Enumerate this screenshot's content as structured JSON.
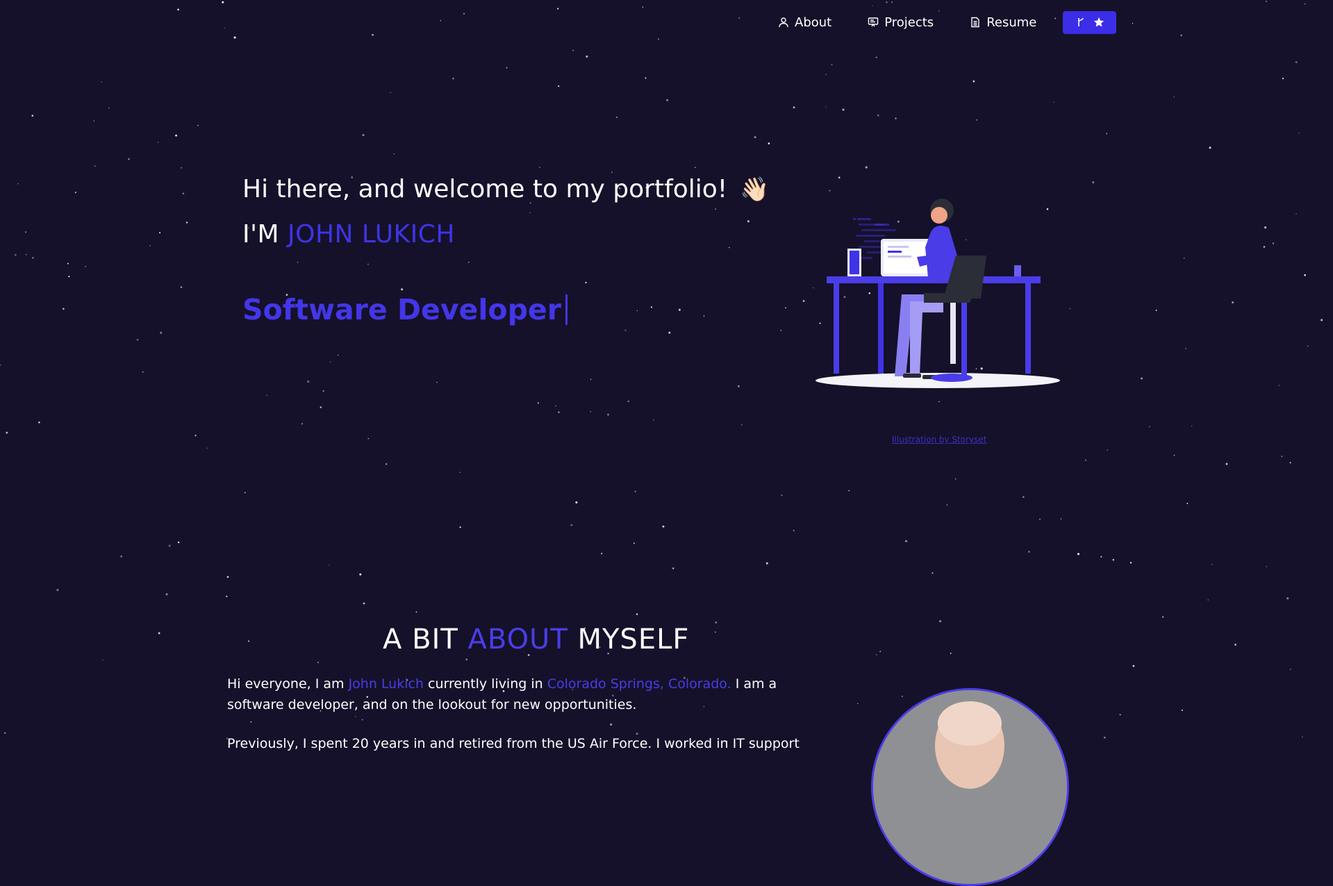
{
  "nav": {
    "items": [
      {
        "label": "About",
        "icon": "user-icon"
      },
      {
        "label": "Projects",
        "icon": "projects-icon"
      },
      {
        "label": "Resume",
        "icon": "document-icon"
      }
    ],
    "github_button": {
      "icons": [
        "fork-icon",
        "star-icon"
      ],
      "color": "#3b2ee6"
    }
  },
  "hero": {
    "greeting": "Hi there, and welcome to my portfolio!",
    "wave": "👋🏻",
    "name_prefix": "I'M",
    "name": "JOHN LUKICH",
    "role": "Software Developer"
  },
  "illustration": {
    "credit": "Illustration by Storyset"
  },
  "about": {
    "title_parts": [
      "A BIT",
      "ABOUT",
      "MYSELF"
    ],
    "intro_1": "Hi everyone, I am",
    "name": "John Lukich",
    "intro_2": "currently living in",
    "location": "Colorado Springs, Colorado.",
    "intro_3": "I am a software developer, and on the lookout for new opportunities.",
    "para_2": "Previously, I spent 20 years in and retired from the US Air Force. I worked in IT support"
  },
  "colors": {
    "background": "#15112a",
    "accent": "#4336e8"
  }
}
